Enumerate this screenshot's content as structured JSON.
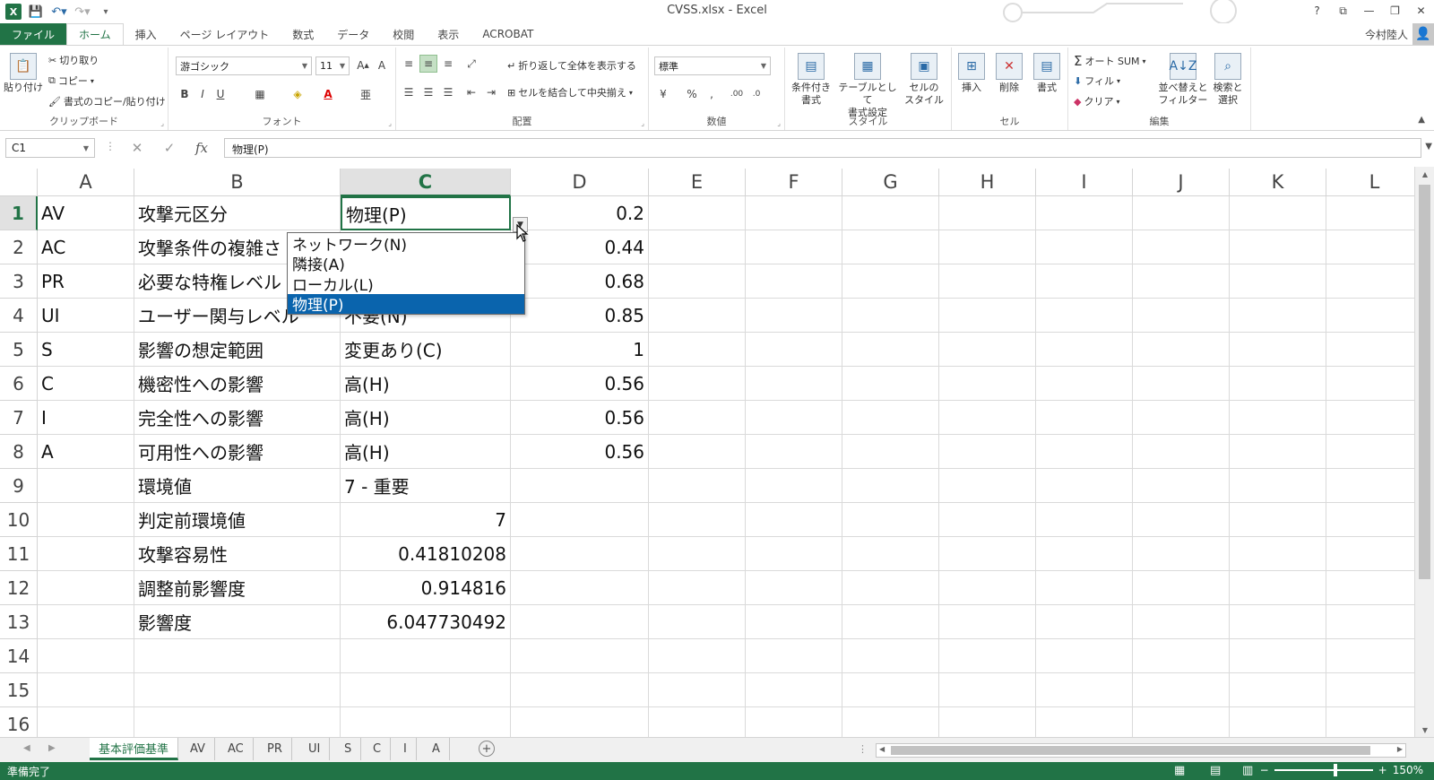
{
  "window": {
    "title": "CVSS.xlsx - Excel",
    "user": "今村陸人",
    "controls": [
      "?",
      "⧉",
      "—",
      "❐",
      "✕"
    ]
  },
  "ribbon_tabs": [
    "ファイル",
    "ホーム",
    "挿入",
    "ページ レイアウト",
    "数式",
    "データ",
    "校閲",
    "表示",
    "ACROBAT"
  ],
  "ribbon": {
    "clipboard": {
      "paste": "貼り付け",
      "cut": "切り取り",
      "copy": "コピー",
      "format_painter": "書式のコピー/貼り付け",
      "label": "クリップボード"
    },
    "font": {
      "name": "游ゴシック",
      "size": "11",
      "bold": "B",
      "italic": "I",
      "underline": "U",
      "label": "フォント"
    },
    "alignment": {
      "wrap": "折り返して全体を表示する",
      "merge": "セルを結合して中央揃え",
      "label": "配置"
    },
    "number": {
      "format": "標準",
      "percent": "%",
      "comma": ",",
      "label": "数値"
    },
    "styles": {
      "conditional_1": "条件付き",
      "conditional_2": "書式",
      "table_1": "テーブルとして",
      "table_2": "書式設定",
      "cell_1": "セルの",
      "cell_2": "スタイル",
      "label": "スタイル"
    },
    "cells": {
      "insert": "挿入",
      "delete": "削除",
      "format": "書式",
      "label": "セル"
    },
    "editing": {
      "autosum": "オート SUM",
      "fill": "フィル",
      "clear": "クリア",
      "sort_1": "並べ替えと",
      "sort_2": "フィルター",
      "find_1": "検索と",
      "find_2": "選択",
      "label": "編集"
    }
  },
  "formula_bar": {
    "name_box": "C1",
    "fx": "fx",
    "content": "物理(P)"
  },
  "grid": {
    "columns": [
      "A",
      "B",
      "C",
      "D",
      "E",
      "F",
      "G",
      "H",
      "I",
      "J",
      "K",
      "L"
    ],
    "selected_column": "C",
    "rows": [
      "1",
      "2",
      "3",
      "4",
      "5",
      "6",
      "7",
      "8",
      "9",
      "10",
      "11",
      "12",
      "13",
      "14",
      "15",
      "16"
    ],
    "selected_row": "1",
    "cells": [
      [
        "AV",
        "攻撃元区分",
        "物理(P)",
        "0.2"
      ],
      [
        "AC",
        "攻撃条件の複雑さ",
        "",
        "0.44"
      ],
      [
        "PR",
        "必要な特権レベル",
        "",
        "0.68"
      ],
      [
        "UI",
        "ユーザー関与レベル",
        "不要(N)",
        "0.85"
      ],
      [
        "S",
        "影響の想定範囲",
        "変更あり(C)",
        "1"
      ],
      [
        "C",
        "機密性への影響",
        "高(H)",
        "0.56"
      ],
      [
        "I",
        "完全性への影響",
        "高(H)",
        "0.56"
      ],
      [
        "A",
        "可用性への影響",
        "高(H)",
        "0.56"
      ],
      [
        "",
        "環境値",
        "7 - 重要",
        ""
      ],
      [
        "",
        "判定前環境値",
        "7",
        ""
      ],
      [
        "",
        "攻撃容易性",
        "0.41810208",
        ""
      ],
      [
        "",
        "調整前影響度",
        "0.914816",
        ""
      ],
      [
        "",
        "影響度",
        "6.047730492",
        ""
      ]
    ]
  },
  "dropdown": {
    "options": [
      "ネットワーク(N)",
      "隣接(A)",
      "ローカル(L)",
      "物理(P)"
    ],
    "selected": "物理(P)"
  },
  "sheet_tabs": [
    "基本評価基準",
    "AV",
    "AC",
    "PR",
    "UI",
    "S",
    "C",
    "I",
    "A"
  ],
  "active_sheet": "基本評価基準",
  "status": {
    "message": "準備完了",
    "zoom": "150%"
  },
  "colors": {
    "excel_green": "#217346",
    "dropdown_highlight": "#0a64ad"
  }
}
